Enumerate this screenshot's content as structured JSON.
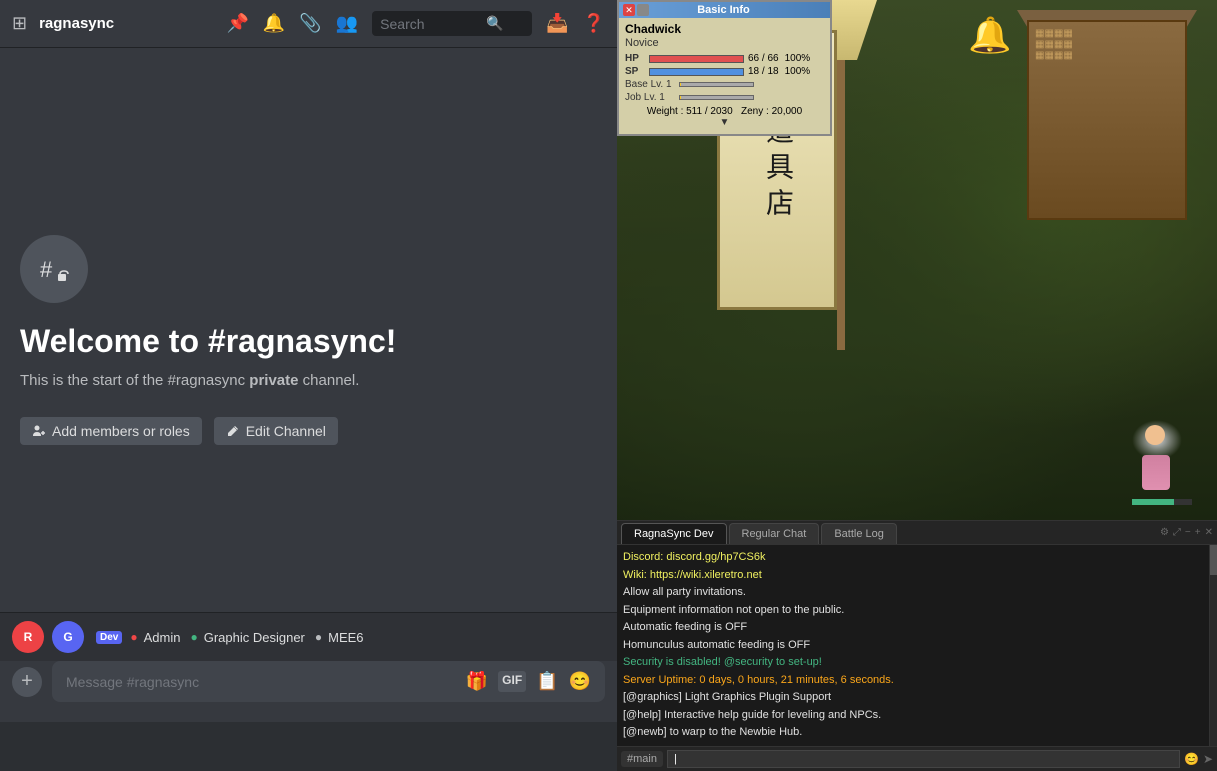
{
  "discord": {
    "server_name": "ragnasync",
    "search_placeholder": "Search",
    "channel_name": "#ragnasync",
    "welcome_title": "Welcome to #ragnasync!",
    "welcome_desc_start": "This is the start of the ",
    "welcome_desc_channel": "#ragnasync",
    "welcome_desc_strong": "private",
    "welcome_desc_end": " channel.",
    "add_members_label": "Add members or roles",
    "edit_channel_label": "Edit Channel",
    "message_placeholder": "Message #ragnasync",
    "members": [
      {
        "name": "R",
        "color": "red",
        "dev": true
      },
      {
        "name": "G",
        "color": "blue",
        "dev": false
      }
    ],
    "roles": [
      {
        "label": "Admin",
        "dot_color": "admin"
      },
      {
        "label": "Graphic Designer",
        "dot_color": "graphic"
      },
      {
        "label": "MEE6",
        "dot_color": "mee6"
      }
    ]
  },
  "game": {
    "basic_info": {
      "title": "Basic Info",
      "char_name": "Chadwick",
      "char_class": "Novice",
      "hp_current": "66",
      "hp_max": "66",
      "hp_percent": "100%",
      "sp_current": "18",
      "sp_max": "18",
      "sp_percent": "100%",
      "base_lv": "Base Lv. 1",
      "job_lv": "Job Lv. 1",
      "weight": "Weight : 511 / 2030",
      "zeny": "Zeny : 20,000"
    },
    "banner_text": "道具店",
    "chat": {
      "tabs": [
        "RagnaSync Dev",
        "Regular Chat",
        "Battle Log"
      ],
      "active_tab": "RagnaSync Dev",
      "messages": [
        {
          "text": "Discord: discord.gg/hp7CS6k",
          "color": "yellow"
        },
        {
          "text": "Wiki: https://wiki.xileretro.net",
          "color": "yellow"
        },
        {
          "text": "Allow all party invitations.",
          "color": "white"
        },
        {
          "text": "Equipment information not open to the public.",
          "color": "white"
        },
        {
          "text": "Automatic feeding is OFF",
          "color": "white"
        },
        {
          "text": "Homunculus automatic feeding is OFF",
          "color": "white"
        },
        {
          "text": "Security is disabled! @security to set-up!",
          "color": "green"
        },
        {
          "text": "Server Uptime: 0 days, 0 hours, 21 minutes, 6 seconds.",
          "color": "orange"
        },
        {
          "text": "[@graphics] Light Graphics Plugin Support",
          "color": "white"
        },
        {
          "text": "[@help] Interactive help guide for leveling and NPCs.",
          "color": "white"
        },
        {
          "text": "[@newb] to warp to the Newbie Hub.",
          "color": "white"
        }
      ],
      "input_channel": "#main",
      "input_value": "|"
    }
  }
}
